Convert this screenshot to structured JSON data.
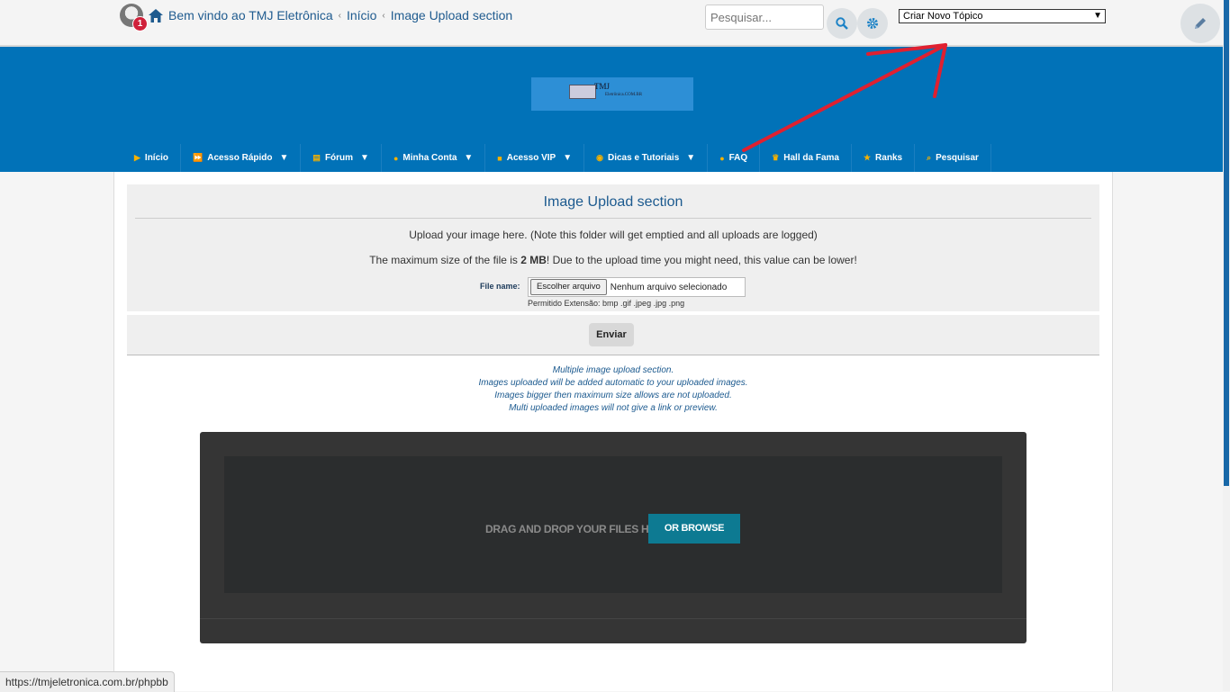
{
  "topbar": {
    "notification_count": "1",
    "breadcrumbs": [
      "Bem vindo ao TMJ Eletrônica",
      "Início",
      "Image Upload section"
    ],
    "search_placeholder": "Pesquisar...",
    "new_topic_select": "Criar Novo Tópico"
  },
  "header": {
    "logo_title": "TMJ",
    "logo_subtitle": "Eletrônica.COM.BR",
    "nav": [
      {
        "label": "Início",
        "icon": "play-icon"
      },
      {
        "label": "Acesso Rápido",
        "icon": "fast-forward-icon",
        "dropdown": true
      },
      {
        "label": "Fórum",
        "icon": "list-icon",
        "dropdown": true
      },
      {
        "label": "Minha Conta",
        "icon": "user-icon",
        "dropdown": true
      },
      {
        "label": "Acesso VIP",
        "icon": "gift-icon",
        "dropdown": true
      },
      {
        "label": "Dicas e Tutoriais",
        "icon": "circle-icon",
        "dropdown": true
      },
      {
        "label": "FAQ",
        "icon": "chat-icon"
      },
      {
        "label": "Hall da Fama",
        "icon": "trophy-icon"
      },
      {
        "label": "Ranks",
        "icon": "star-icon"
      },
      {
        "label": "Pesquisar",
        "icon": "search-icon"
      }
    ]
  },
  "upload": {
    "title": "Image Upload section",
    "intro": "Upload your image here. (Note this folder will get emptied and all uploads are logged)",
    "max_pre": "The maximum size of the file is ",
    "max_value": "2 MB",
    "max_post": "! Due to the upload time you might need, this value can be lower!",
    "file_label": "File name:",
    "choose_button": "Escolher arquivo",
    "no_file": "Nenhum arquivo selecionado",
    "allowed": "Permitido Extensão:  bmp .gif .jpeg .jpg .png",
    "send_button": "Enviar"
  },
  "multi": {
    "lines": [
      "Multiple image upload section.",
      "Images uploaded will be added automatic to your uploaded images.",
      "Images bigger then maximum size allows are not uploaded.",
      "Multi uploaded images will not give a link or preview."
    ],
    "drop_text": "DRAG AND DROP YOUR FILES HERE",
    "browse_button": "OR BROWSE"
  },
  "status_url": "https://tmjeletronica.com.br/phpbb",
  "colors": {
    "header_blue": "#0172b8",
    "accent_teal": "#0d7a92",
    "annotation_red": "#e02030"
  }
}
